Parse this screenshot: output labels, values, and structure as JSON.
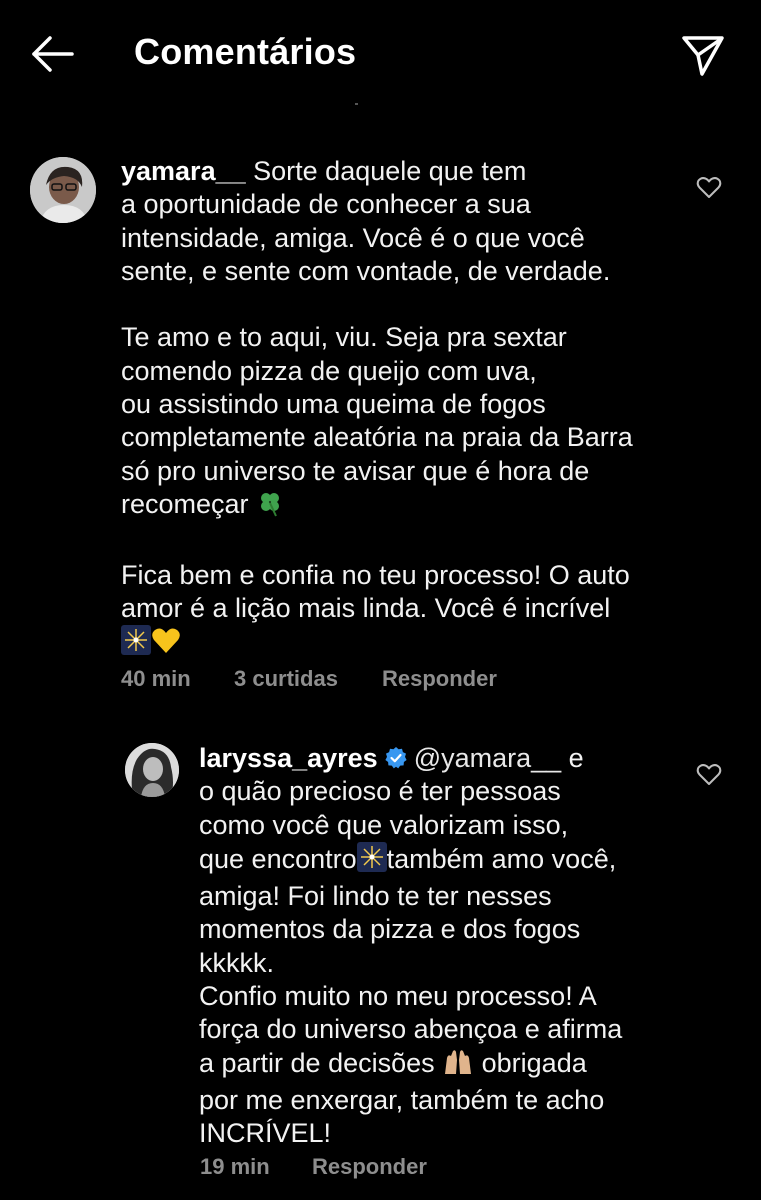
{
  "header": {
    "title": "Comentários",
    "back_icon": "arrow-left-icon",
    "share_icon": "paper-plane-icon"
  },
  "comments": [
    {
      "username": "yamara__",
      "paragraphs": [
        "Sorte daquele que tem\na oportunidade de conhecer a sua\nintensidade, amiga. Você é o que você\nsente, e sente com vontade, de verdade.",
        "Te amo e to aqui, viu. Seja pra sextar\ncomendo pizza de queijo com uva,\nou assistindo uma queima de fogos\ncompletamente aleatória na praia da Barra\nsó pro universo te avisar que é hora de\nrecomeçar",
        "Fica bem e confia no teu processo! O auto\namor é a lição mais linda. Você é incrível"
      ],
      "time": "40 min",
      "likes": "3 curtidas",
      "reply": "Responder",
      "like_icon": "heart-outline-icon"
    },
    {
      "username": "laryssa_ayres",
      "verified": true,
      "mention": "@yamara__",
      "text_part1": " e\no quão precioso é ter pessoas\ncomo você que valorizam isso,\nque encontro",
      "text_part2": "também amo você,\namiga! Foi lindo te ter nesses\nmomentos da pizza e dos fogos\nkkkkk.\nConfio muito no meu processo! A\nforça do universo abençoa e afirma\na partir de decisões ",
      "text_part3": " obrigada\npor me enxergar, também te acho\nINCRÍVEL!",
      "time": "19 min",
      "reply": "Responder",
      "like_icon": "heart-outline-icon"
    }
  ],
  "colors": {
    "background": "#000000",
    "text": "#f2f2f2",
    "meta": "#8e8e8e",
    "verified": "#3897f0"
  }
}
